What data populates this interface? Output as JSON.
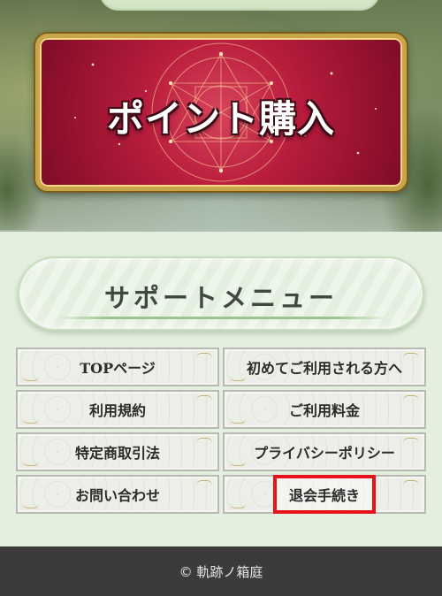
{
  "banner": {
    "title": "ポイント購入"
  },
  "support": {
    "title": "サポートメニュー"
  },
  "menu": {
    "items": [
      {
        "label": "TOPページ"
      },
      {
        "label": "初めてご利用される方へ"
      },
      {
        "label": "利用規約"
      },
      {
        "label": "ご利用料金"
      },
      {
        "label": "特定商取引法"
      },
      {
        "label": "プライバシーポリシー"
      },
      {
        "label": "お問い合わせ"
      },
      {
        "label": "退会手続き"
      }
    ]
  },
  "footer": {
    "copyright": "© 軌跡ノ箱庭"
  },
  "colors": {
    "banner_red": "#b81c3c",
    "gold_frame": "#c9a54a",
    "highlight_red": "#e8121a",
    "footer_bg": "#3a3b3a"
  }
}
